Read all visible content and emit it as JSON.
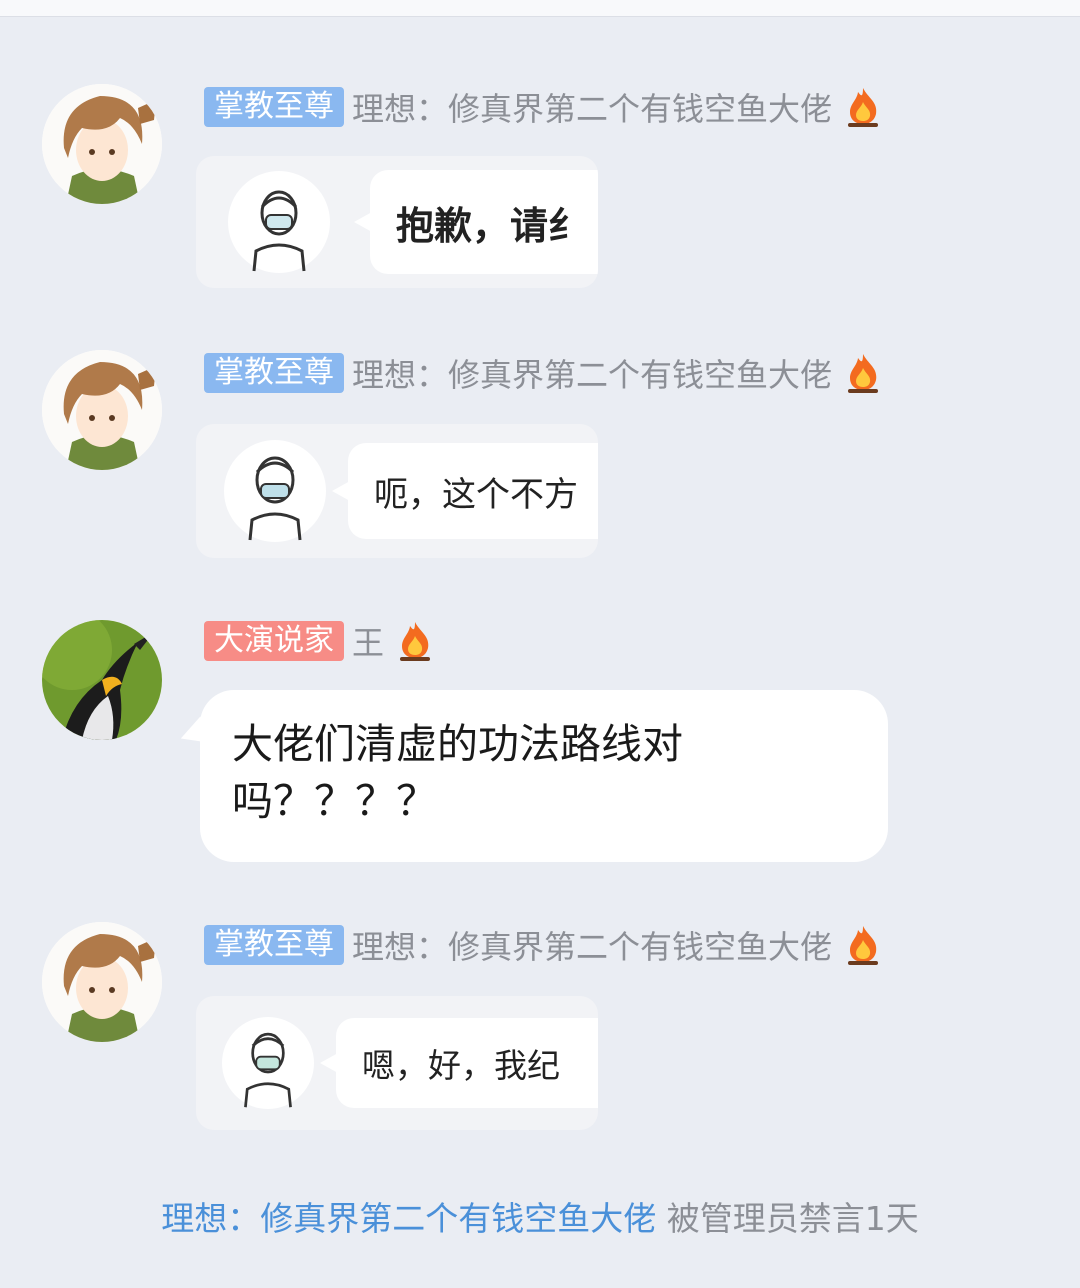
{
  "colors": {
    "background": "#eaedf3",
    "badge_blue": "#8ab8f0",
    "badge_red": "#f78c86",
    "nick_gray": "#8c8f96",
    "system_link": "#4a90d9"
  },
  "messages": [
    {
      "badge": "掌教至尊",
      "nickname": "理想：修真界第二个有钱空鱼大佬",
      "status_icon": "fire-icon",
      "type": "sticker",
      "sticker_text": "抱歉，请纟"
    },
    {
      "badge": "掌教至尊",
      "nickname": "理想：修真界第二个有钱空鱼大佬",
      "status_icon": "fire-icon",
      "type": "sticker",
      "sticker_text": "呃，这个不方"
    },
    {
      "badge": "大演说家",
      "nickname": "王",
      "status_icon": "fire-icon",
      "type": "text",
      "text_line1": "大佬们清虚的功法路线对",
      "text_line2": "吗？？？？"
    },
    {
      "badge": "掌教至尊",
      "nickname": "理想：修真界第二个有钱空鱼大佬",
      "status_icon": "fire-icon",
      "type": "sticker",
      "sticker_text": "嗯，好，我纪"
    }
  ],
  "system_notice": {
    "name": "理想：修真界第二个有钱空鱼大佬",
    "text": " 被管理员禁言1天"
  }
}
